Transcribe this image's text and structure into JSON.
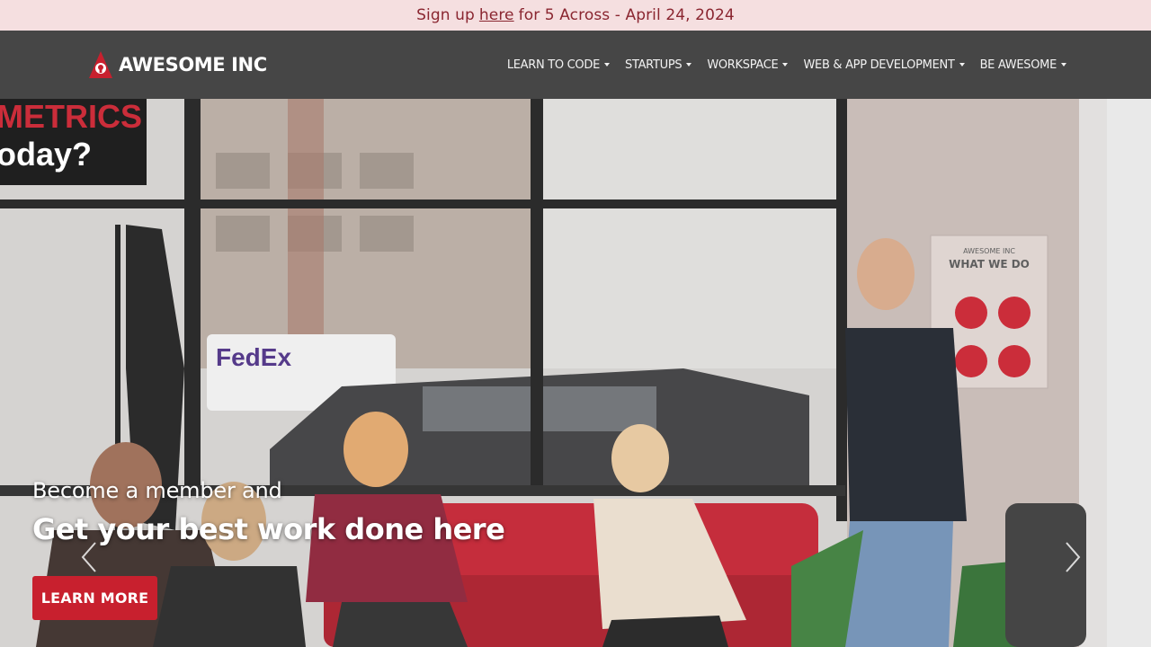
{
  "announcement": {
    "prefix": "Sign up",
    "link": "here",
    "suffix": "for 5 Across - April 24, 2024"
  },
  "header": {
    "logo_text": "AWESOME INC",
    "nav": [
      {
        "label": "LEARN TO CODE"
      },
      {
        "label": "STARTUPS"
      },
      {
        "label": "WORKSPACE"
      },
      {
        "label": "WEB & APP DEVELOPMENT"
      },
      {
        "label": "BE AWESOME"
      }
    ]
  },
  "hero": {
    "subtitle": "Become a member and",
    "title": "Get your best work done here",
    "cta_label": "LEARN MORE",
    "wall_sign": {
      "line1": "AWESOME INC",
      "line2": "WHAT WE DO"
    },
    "window_sign": "METRICS",
    "window_sign2": "oday?",
    "truck_text": "FedEx"
  },
  "colors": {
    "accent": "#c8202e",
    "header_bg": "#464646",
    "announce_bg": "#f5dfe0",
    "announce_text": "#8a2630"
  }
}
